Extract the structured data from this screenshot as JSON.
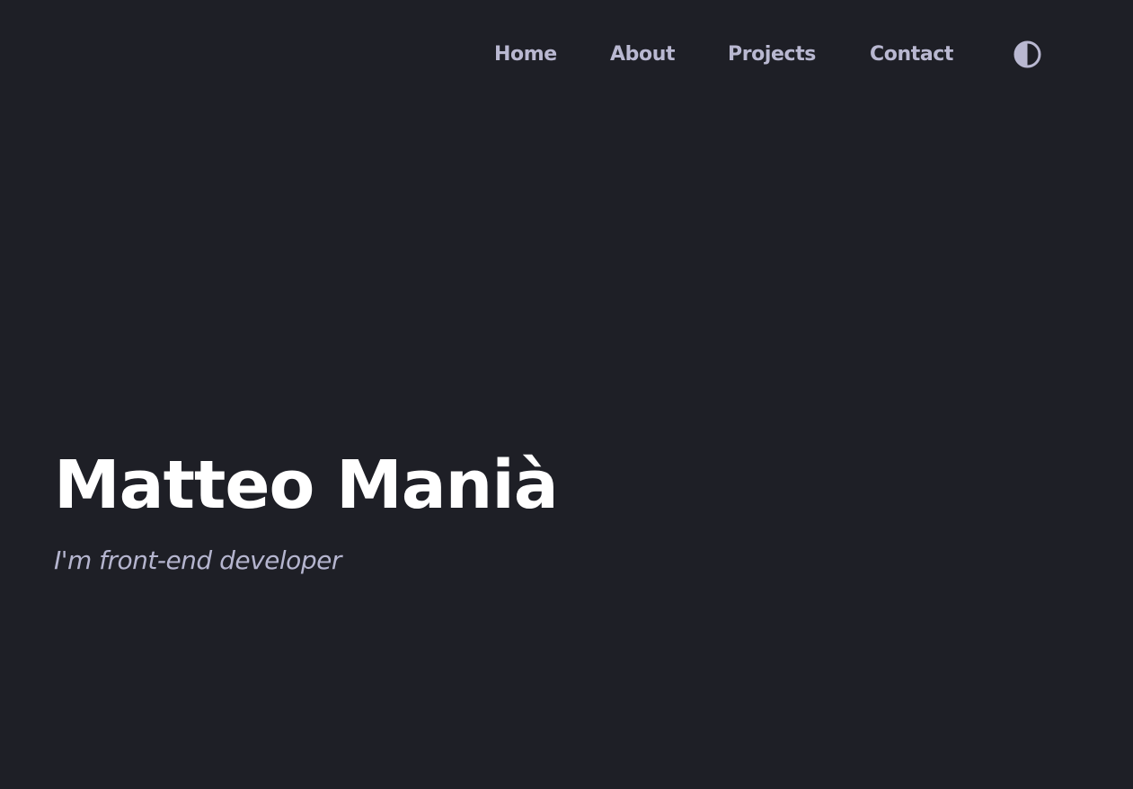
{
  "nav": {
    "items": [
      {
        "label": "Home"
      },
      {
        "label": "About"
      },
      {
        "label": "Projects"
      },
      {
        "label": "Contact"
      }
    ],
    "theme_toggle_icon": "contrast-half-circle-icon"
  },
  "hero": {
    "name": "Matteo Manià",
    "subtitle": "I'm front-end developer"
  },
  "colors": {
    "background": "#1e1f26",
    "nav_text": "#b9b8d1",
    "heading": "#ffffff",
    "subtitle": "#b5b5cf"
  }
}
